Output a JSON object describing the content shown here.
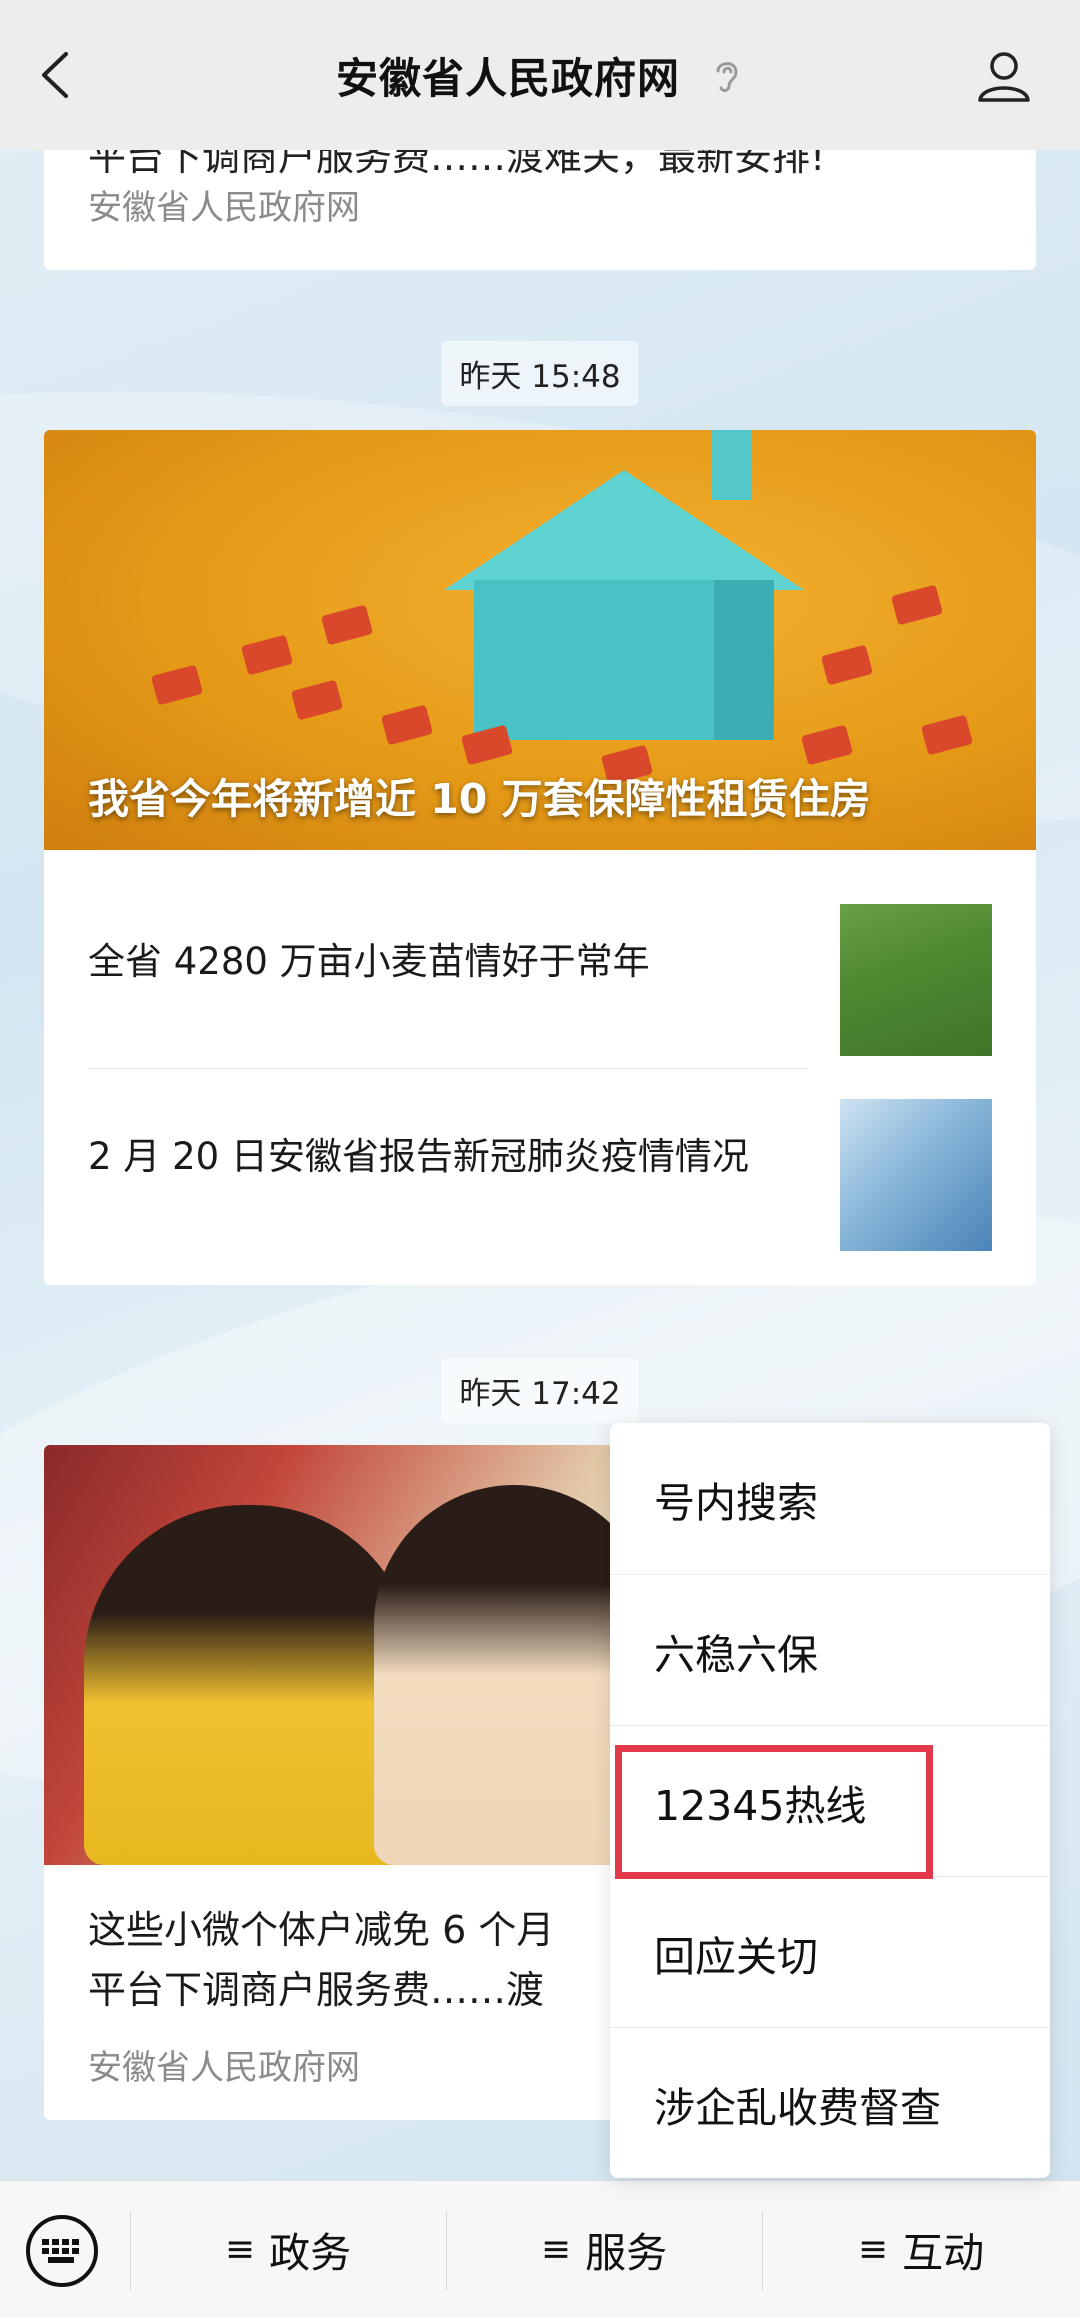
{
  "header": {
    "title": "安徽省人民政府网",
    "back_icon": "chevron-left-icon",
    "ear_icon": "ear-icon",
    "profile_icon": "person-icon"
  },
  "feed": {
    "card1": {
      "title": "平台下调商户服务费……渡难关，最新安排!",
      "source": "安徽省人民政府网"
    },
    "time1": "昨天 15:48",
    "card2": {
      "hero_caption": "我省今年将新增近 10 万套保障性租赁住房",
      "items": [
        {
          "title": "全省 4280 万亩小麦苗情好于常年"
        },
        {
          "title": "2 月 20 日安徽省报告新冠肺炎疫情情况"
        }
      ]
    },
    "time2": "昨天 17:42",
    "card3": {
      "title_line1": "这些小微个体户减免 6 个月",
      "title_line2": "平台下调商户服务费……渡",
      "source": "安徽省人民政府网"
    }
  },
  "popup_menu": {
    "items": [
      {
        "label": "号内搜索"
      },
      {
        "label": "六稳六保"
      },
      {
        "label": "12345热线"
      },
      {
        "label": "回应关切"
      },
      {
        "label": "涉企乱收费督查"
      }
    ],
    "highlight_color": "#e33a4a"
  },
  "bottom_bar": {
    "keyboard_icon": "keyboard-icon",
    "menus": [
      {
        "icon": "≡",
        "label": "政务"
      },
      {
        "icon": "≡",
        "label": "服务"
      },
      {
        "icon": "≡",
        "label": "互动"
      }
    ]
  }
}
